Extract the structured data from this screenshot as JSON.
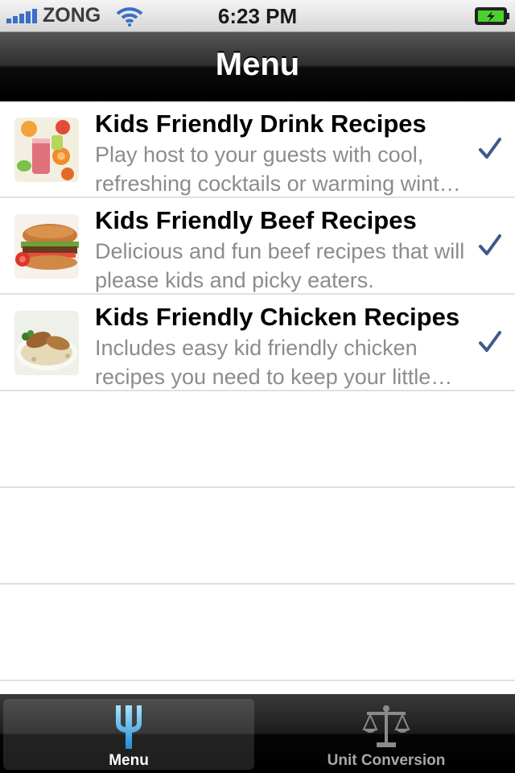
{
  "status_bar": {
    "carrier": "ZONG",
    "time": "6:23 PM"
  },
  "nav": {
    "title": "Menu"
  },
  "colors": {
    "checkmark": "#3d5a8c",
    "subtitle": "#8c8c8c",
    "battery": "#4bd12b"
  },
  "rows": [
    {
      "title": "Kids Friendly Drink Recipes",
      "subtitle": "Play host to your guests with cool, refreshing cocktails or warming winter drinks.",
      "thumbnail": "drinks-photo",
      "checked": true
    },
    {
      "title": "Kids Friendly Beef Recipes",
      "subtitle": "Delicious and fun beef recipes that will please kids and picky eaters.",
      "thumbnail": "burger-photo",
      "checked": true
    },
    {
      "title": "Kids Friendly Chicken Recipes",
      "subtitle": "Includes easy kid friendly chicken recipes you need to keep your little ones happy.",
      "thumbnail": "chicken-photo",
      "checked": true
    }
  ],
  "tabs": [
    {
      "label": "Menu",
      "icon": "fork-icon",
      "selected": true
    },
    {
      "label": "Unit Conversion",
      "icon": "scale-icon",
      "selected": false
    }
  ]
}
